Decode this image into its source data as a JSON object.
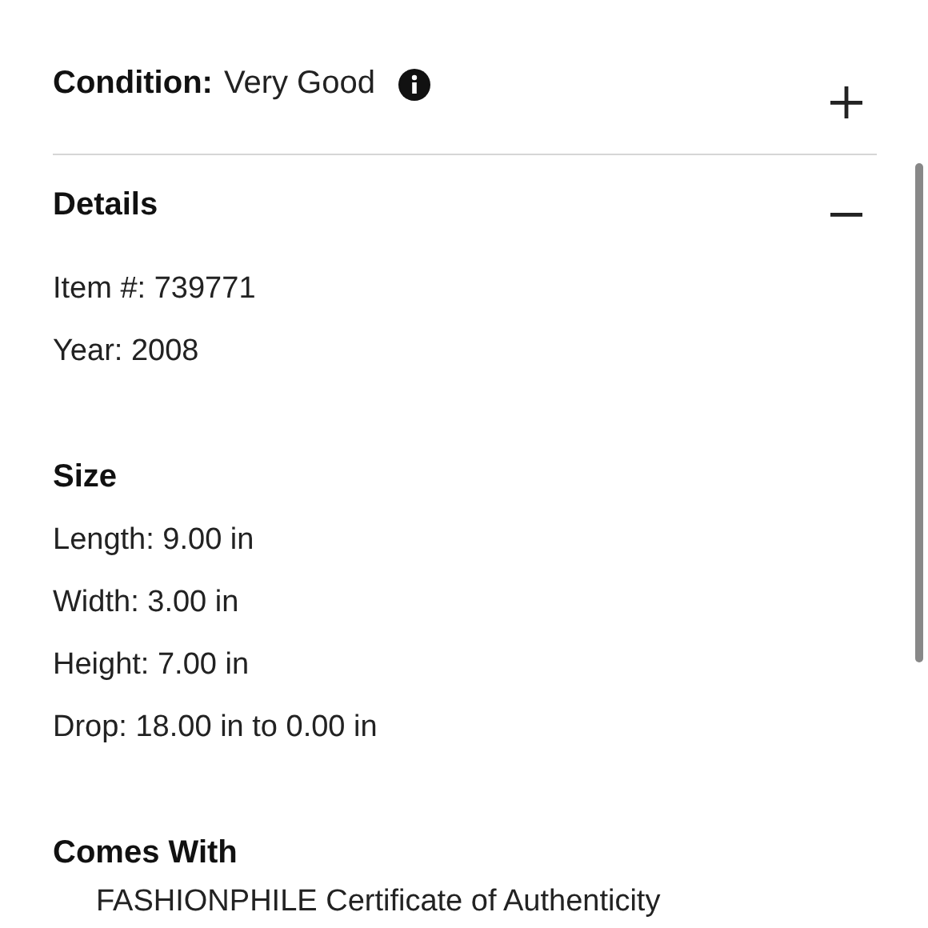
{
  "sections": [
    {
      "title": "Condition:",
      "value": "Very Good",
      "info": true,
      "expanded": false
    },
    {
      "title": "Details",
      "expanded": true,
      "groups": [
        {
          "lines": [
            "Item #: 739771",
            "Year: 2008"
          ]
        },
        {
          "heading": "Size",
          "lines": [
            "Length: 9.00 in",
            "Width: 3.00 in",
            "Height: 7.00 in",
            "Drop: 18.00 in to 0.00 in"
          ]
        },
        {
          "heading": "Comes With",
          "bullets": [
            "FASHIONPHILE Certificate of Authenticity"
          ]
        }
      ]
    }
  ]
}
